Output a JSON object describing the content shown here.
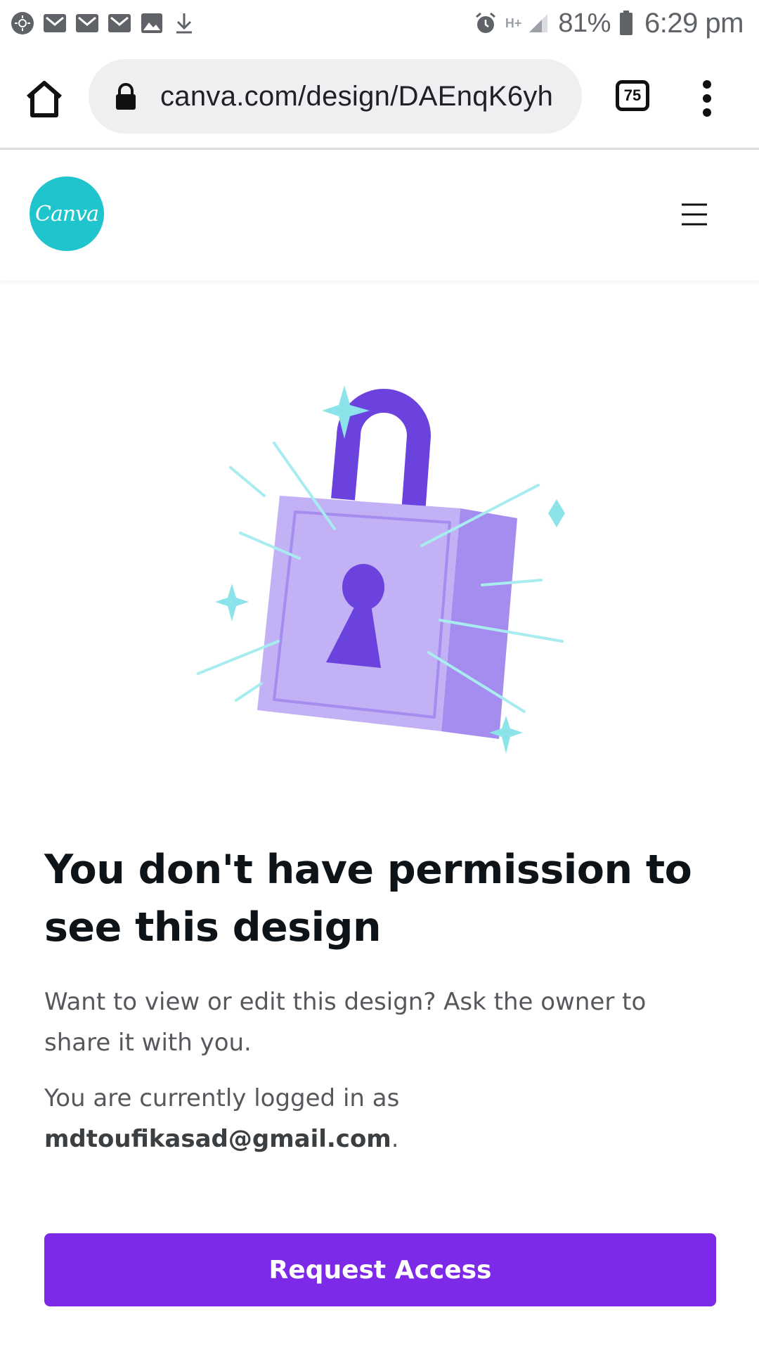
{
  "status_bar": {
    "left_icons": [
      "weather-icon",
      "gmail-icon",
      "gmail-icon",
      "gmail-icon",
      "gallery-icon",
      "download-icon"
    ],
    "network": "H+",
    "battery": "81%",
    "time": "6:29 pm"
  },
  "browser": {
    "url": "canva.com/design/DAEnqK6yh",
    "tab_count": "75"
  },
  "site": {
    "logo_text": "Canva",
    "brand_color": "#1fc4cc"
  },
  "content": {
    "heading": "You don't have permission to see this design",
    "paragraph1": "Want to view or edit this design? Ask the owner to share it with you.",
    "logged_in_prefix": "You are currently logged in as",
    "email": "mdtoufikasad@gmail.com",
    "logged_in_suffix": ".",
    "button_label": "Request Access",
    "button_color": "#7d2ae8"
  }
}
